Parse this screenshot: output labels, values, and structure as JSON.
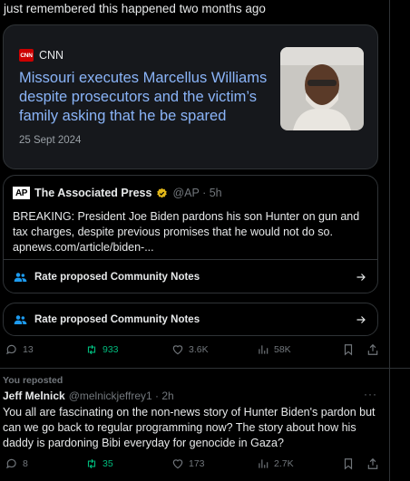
{
  "intro_text": "just remembered this happened two months ago",
  "news_card": {
    "source": "CNN",
    "logo_text": "CNN",
    "headline": "Missouri executes Marcellus Williams despite prosecutors and the victim’s family asking that he be spared",
    "date": "25 Sept 2024"
  },
  "quoted_post": {
    "logo_text": "AP",
    "author": "The Associated Press",
    "handle_time": "@AP · 5h",
    "body": "BREAKING: President Joe Biden pardons his son Hunter on gun and tax charges, despite previous promises that he would not do so. apnews.com/article/biden-...",
    "notes_label": "Rate proposed Community Notes"
  },
  "notes_button_label": "Rate proposed Community Notes",
  "actions_top": {
    "replies": "13",
    "reposts": "933",
    "likes": "3.6K",
    "views": "58K"
  },
  "repost_label": "You reposted",
  "tweet": {
    "author": "Jeff Melnick",
    "handle_time": "@melnickjeffrey1 · 2h",
    "more": "···",
    "body": "You all are fascinating on the non-news story of Hunter Biden's pardon but can we go back to regular programming now? The story about how his daddy is pardoning Bibi everyday for genocide in Gaza?"
  },
  "actions_bottom": {
    "replies": "8",
    "reposts": "35",
    "likes": "173",
    "views": "2.7K"
  },
  "colors": {
    "accent": "#1d9bf0",
    "repost_green": "#00ba7c",
    "link_blue": "#8ab4f8",
    "verified_gold": "#e2b719"
  }
}
